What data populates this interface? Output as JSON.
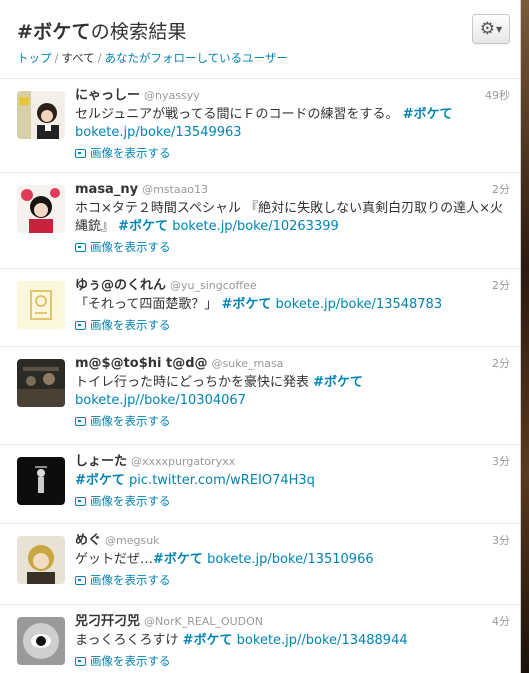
{
  "header": {
    "title_tag": "#ボケて",
    "title_suffix": "の検索結果",
    "breadcrumb": [
      "トップ",
      "すべて",
      "あなたがフォローしているユーザー"
    ]
  },
  "tweets": [
    {
      "name": "にゃっしー",
      "handle": "@nyassyy",
      "time": "49秒",
      "text": "セルジュニアが戦ってる間にＦのコードの練習をする。",
      "hashtag": "#ボケて",
      "url": "bokete.jp/boke/13549963",
      "media_label": "画像を表示する"
    },
    {
      "name": "masa_ny",
      "handle": "@mstaao13",
      "time": "2分",
      "text": "ホコ×タテ２時間スペシャル 『絶対に失敗しない真剣白刃取りの達人×火縄銃』",
      "hashtag": "#ボケて",
      "url": "bokete.jp/boke/10263399",
      "media_label": "画像を表示する"
    },
    {
      "name": "ゆぅ@のくれん",
      "handle": "@yu_singcoffee",
      "time": "2分",
      "text": "「それって四面楚歌？」",
      "hashtag": "#ボケて",
      "url": "bokete.jp/boke/13548783",
      "media_label": "画像を表示する"
    },
    {
      "name": "m@$@to$hi t@d@",
      "handle": "@suke_masa",
      "time": "2分",
      "text": "トイレ行った時にどっちかを豪快に発表",
      "hashtag": "#ボケて",
      "url": "bokete.jp//boke/10304067",
      "media_label": "画像を表示する"
    },
    {
      "name": "しょーた",
      "handle": "@xxxxpurgatoryxx",
      "time": "3分",
      "text": "",
      "hashtag": "#ボケて",
      "url": "pic.twitter.com/wREIO74H3q",
      "media_label": "画像を表示する"
    },
    {
      "name": "めぐ",
      "handle": "@megsuk",
      "time": "3分",
      "text": "ゲットだぜ…",
      "hashtag": "#ボケて",
      "url": "bokete.jp/boke/13510966",
      "media_label": "画像を表示する"
    },
    {
      "name": "兕刁幵刁兕",
      "handle": "@NorK_REAL_OUDON",
      "time": "4分",
      "text": "まっくろくろすけ",
      "hashtag": "#ボケて",
      "url": "bokete.jp//boke/13488944",
      "media_label": "画像を表示する"
    }
  ],
  "icons": {
    "settings": "gear-icon",
    "media": "image-icon"
  },
  "colors": {
    "link": "#0084b4",
    "text": "#333333",
    "meta": "#999999"
  }
}
